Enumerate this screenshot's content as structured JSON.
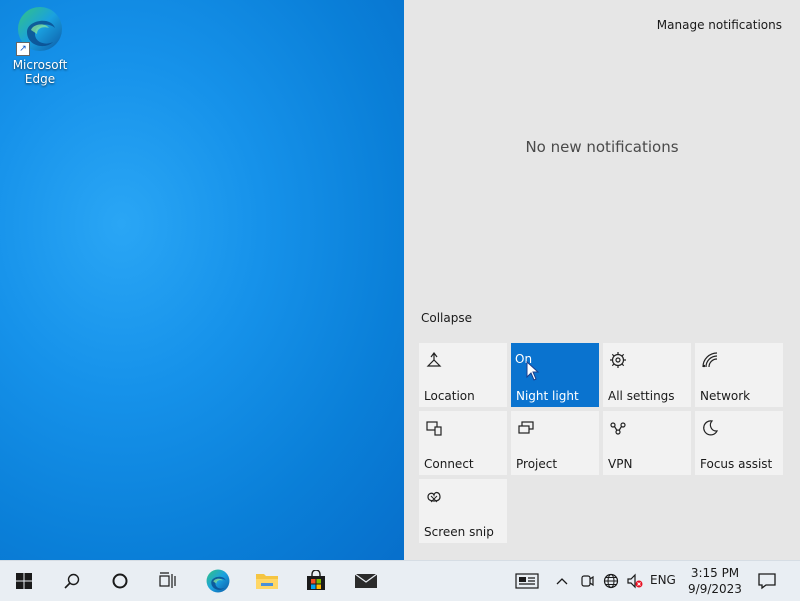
{
  "desktop": {
    "icons": [
      {
        "label": "Microsoft\nEdge",
        "icon": "edge-icon"
      }
    ]
  },
  "action_center": {
    "manage_label": "Manage notifications",
    "empty_label": "No new notifications",
    "collapse_label": "Collapse",
    "tiles": [
      {
        "label": "Location",
        "icon": "location-icon",
        "active": false
      },
      {
        "label": "Night light",
        "icon": "night-light-icon",
        "active": true,
        "state": "On"
      },
      {
        "label": "All settings",
        "icon": "gear-icon",
        "active": false
      },
      {
        "label": "Network",
        "icon": "network-icon",
        "active": false
      },
      {
        "label": "Connect",
        "icon": "connect-icon",
        "active": false
      },
      {
        "label": "Project",
        "icon": "project-icon",
        "active": false
      },
      {
        "label": "VPN",
        "icon": "vpn-icon",
        "active": false
      },
      {
        "label": "Focus assist",
        "icon": "moon-icon",
        "active": false
      },
      {
        "label": "Screen snip",
        "icon": "screen-snip-icon",
        "active": false
      }
    ]
  },
  "taskbar": {
    "items": [
      "start-icon",
      "search-icon",
      "cortana-icon",
      "task-view-icon",
      "edge-icon",
      "file-explorer-icon",
      "store-icon",
      "mail-icon"
    ],
    "tray": [
      "news-icon",
      "chevron-up-icon",
      "meet-now-icon",
      "network-globe-icon",
      "volume-muted-icon"
    ],
    "language": "ENG",
    "time": "3:15 PM",
    "date": "9/9/2023"
  },
  "colors": {
    "accent": "#0a73cf",
    "panel": "#e6e6e6",
    "tile": "#f2f2f2",
    "taskbar": "#e9eef3"
  }
}
